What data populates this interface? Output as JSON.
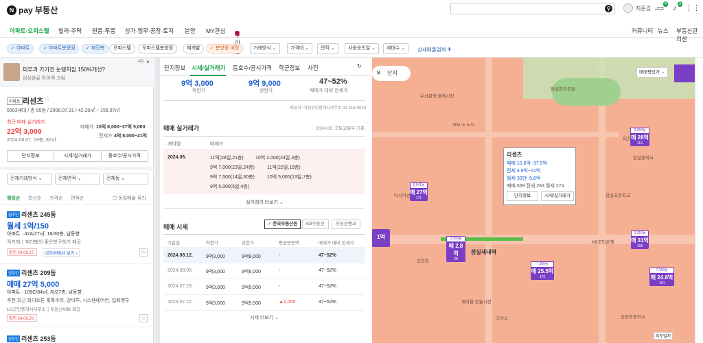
{
  "header": {
    "logo_n": "N",
    "logo": "pay 부동산",
    "user": "지준김",
    "badge_note": "1",
    "badge_chat": "4",
    "badge_bell": "3"
  },
  "nav": {
    "items": [
      "아파트·오피스텔",
      "빌라·주택",
      "원룸·투룸",
      "상가·업무·공장·토지",
      "분양",
      "MY관심",
      "우리집"
    ],
    "right": [
      "커뮤니티",
      "뉴스",
      "부동산관리센"
    ]
  },
  "filters": {
    "chips": [
      "아파트",
      "아파트분양권",
      "재건축",
      "오피스텔",
      "오피스텔분양권",
      "재개발",
      "분양중·예정"
    ],
    "selects": [
      "거래방식",
      "가격대",
      "면적",
      "사용승인일",
      "세대수"
    ],
    "more": "상세매물검색"
  },
  "ad": {
    "tag": "AD",
    "text": "피부과 가기전 눈탱처짐 156%개선?",
    "sub": "임상완료 아이렉 크림"
  },
  "complex": {
    "type": "아파트",
    "name": "리센츠",
    "info": "5563세대 / 총 65동 / 2008.07.31 / 42.28㎡ ~ 158.87㎡",
    "recent_label": "최근 매매 실거래가",
    "recent_price": "22억 3,000",
    "recent_date": "2024.08.07, 19층, 82㎡",
    "sale_label": "매매가",
    "sale": "10억 8,000~37억 5,000",
    "rent_label": "전세가",
    "rent": "4억 8,000~21억",
    "btns": [
      "단지정보",
      "시세/실거래가",
      "동호수/공시가격"
    ]
  },
  "listfilter": {
    "sel": [
      "전체거래방식",
      "전체면적",
      "전체동"
    ],
    "sort": [
      "랭킹순",
      "최신순",
      "가격순",
      "면적순"
    ],
    "same": "동일매물 묶기"
  },
  "listings": [
    {
      "tag": "집주인",
      "name": "리센츠 245동",
      "price": "월세 1억/150",
      "type": "아파트 · 42A/27㎡, 18/30층, 남동향",
      "desc": "직거래 ∣ 피터팬의 좋은방구하기 제공",
      "date": "확인 24.08.17.",
      "extra": "네이버에서 보기"
    },
    {
      "tag": "집주인",
      "name": "리센츠 209동",
      "price": "매매 27억 5,000",
      "type": "아파트 · 109C/84㎡, 저/27층, 남동향",
      "desc": "추천 최근 화이트톤 톡톡수리, 강아투, 시스템에어컨, 입퇴맹투",
      "agent": "LG공인중개사사무소 ∣ 부동산써브 제공",
      "date": "확인 24.08.20."
    },
    {
      "tag": "집주인",
      "name": "리센츠 253동"
    }
  ],
  "detail": {
    "tabs": [
      "단지정보",
      "시세/실거래가",
      "동호수/공시가격",
      "학군정보",
      "사진"
    ],
    "top": {
      "low": "9억 3,000",
      "low_l": "하한가",
      "high": "9억 9,000",
      "high_l": "상한가",
      "ratio": "47~52%",
      "ratio_l": "매매가 대비 전세가"
    },
    "source": "제공처: 대림공인중개사사무소 02-418-0049",
    "real_title": "매매 실거래가",
    "real_note": "2024.08. 국토교통부 기준",
    "real_head": [
      "계약월",
      "매매가"
    ],
    "real_month": "2024.06.",
    "real_rows": [
      [
        "11억(28일,21층)",
        "10억 2,000(24일,3층)"
      ],
      [
        "9억 7,000(23일,24층)",
        "11억(22일,19층)"
      ],
      [
        "9억 7,500(14일,30층)",
        "10억 5,000(13일,7층)"
      ],
      [
        "9억 5,000(5일,4층)",
        ""
      ]
    ],
    "real_more": "실거래가 더보기",
    "price_title": "매매 시세",
    "price_tabs": [
      "한국부동산원",
      "KB부동산",
      "부동산뱅크"
    ],
    "price_head": [
      "기준일",
      "하한가",
      "상한가",
      "평균변동액",
      "매매가 대비 전세가"
    ],
    "price_rows": [
      [
        "2024.08.12.",
        "9억3,000",
        "9억9,000",
        "-",
        "47~52%"
      ],
      [
        "2024.08.05.",
        "9억3,000",
        "9억9,000",
        "-",
        "47~52%"
      ],
      [
        "2024.07.29.",
        "9억3,000",
        "9억9,000",
        "-",
        "47~52%"
      ],
      [
        "2024.07.22.",
        "9억3,000",
        "9억9,000",
        "▲1,000",
        "47~52%"
      ]
    ],
    "price_more": "시세 더보기"
  },
  "map": {
    "close": "단지",
    "sortsel": "매매평당가",
    "popup": {
      "name": "리센츠",
      "sale": "매매 10.8억~37.5억",
      "jeon": "전세 4.8억~21억",
      "wol": "월세 30만~5.8억",
      "counts": "매매 639 전세 283 월세 274",
      "b1": "단지정보",
      "b2": "시세/실거래가"
    },
    "markers": [
      {
        "t": "8,941동",
        "m": "매 27억",
        "s": "171"
      },
      {
        "t": "3,399동",
        "m": "매 2.8억",
        "s": "28"
      },
      {
        "t": "9,264동",
        "m": "매 28억",
        "s": "113"
      },
      {
        "t": "7,380동",
        "m": "매 25.5억",
        "s": "170"
      },
      {
        "t": "1,310동",
        "m": "매 31억",
        "s": "108"
      },
      {
        "t": "7,163동",
        "m": "매 24.8억",
        "s": "114"
      },
      {
        "t": "",
        "m": "1억",
        "s": ""
      }
    ],
    "labels": [
      "수산관광 물레시장",
      "잠실한강공원",
      "잠실대교",
      "잠실중학교",
      "잠실초등학교",
      "5단지아파트",
      "잠실주공 5단지아파트",
      "잠실3관레이크팰리스",
      "아시아선수촌",
      "KB국민은행",
      "잠실새내역",
      "신천동",
      "새마을 전통시장",
      "다이소",
      "잠실초교",
      "송전초등학교",
      "지토벌처"
    ],
    "road": "RM 소 노드"
  }
}
